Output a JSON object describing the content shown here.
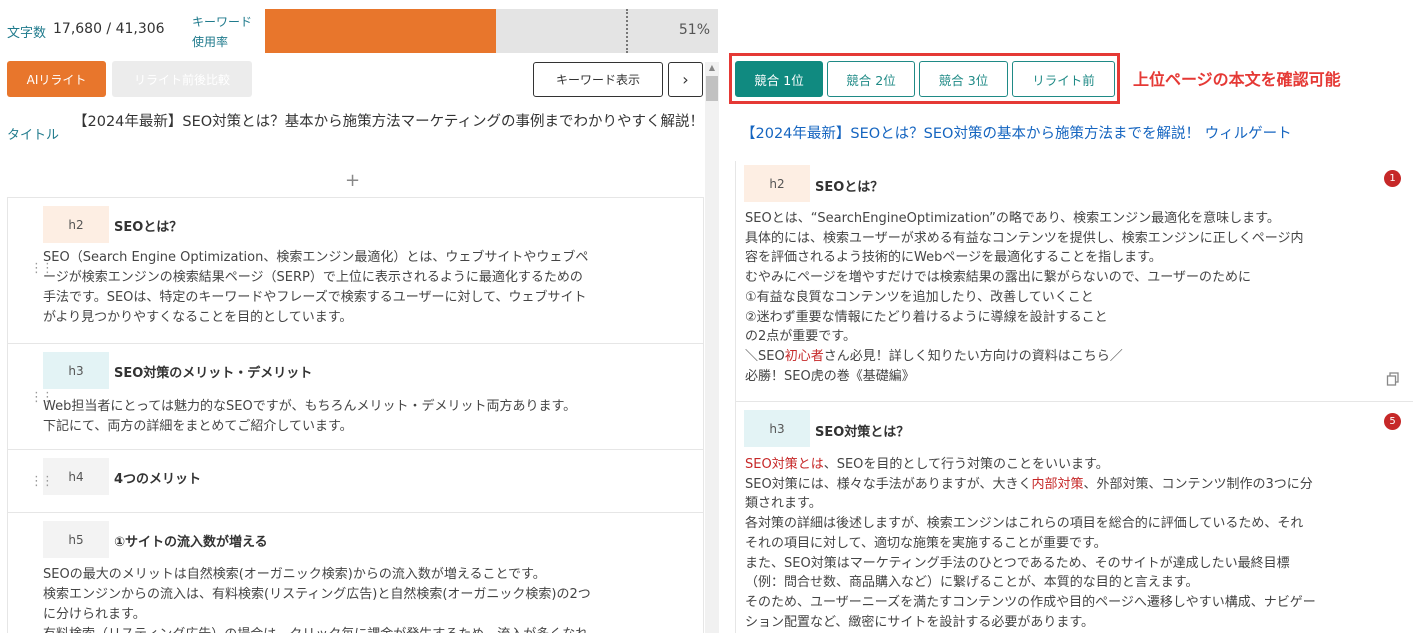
{
  "header": {
    "word_count_label": "文字数",
    "word_count_value": "17,680 / 41,306",
    "keyword_rate_label_1": "キーワード",
    "keyword_rate_label_2": "使用率",
    "keyword_rate": 51,
    "keyword_rate_text": "51%"
  },
  "toolbar": {
    "ai_rewrite": "AIリライト",
    "compare": "リライト前後比較",
    "keyword_display": "キーワード表示",
    "next": "›"
  },
  "article": {
    "title_label": "タイトル",
    "title": "【2024年最新】SEO対策とは？基本から施策方法マーケティングの事例までわかりやすく解説！",
    "add": "+",
    "blocks": [
      {
        "level": "h2",
        "heading": "SEOとは？",
        "lines": [
          "SEO（Search Engine Optimization、検索エンジン最適化）とは、ウェブサイトやウェブペ",
          "ージが検索エンジンの検索結果ページ（SERP）で上位に表示されるように最適化するための",
          "手法です。SEOは、特定のキーワードやフレーズで検索するユーザーに対して、ウェブサイト",
          "がより見つかりやすくなることを目的としています。"
        ]
      },
      {
        "level": "h3",
        "heading": "SEO対策のメリット・デメリット",
        "lines": [
          "Web担当者にとっては魅力的なSEOですが、もちろんメリット・デメリット両方あります。",
          "下記にて、両方の詳細をまとめてご紹介しています。"
        ]
      },
      {
        "level": "h4",
        "heading": "4つのメリット",
        "lines": []
      },
      {
        "level": "h5",
        "heading": "①サイトの流入数が増える",
        "lines": [
          "SEOの最大のメリットは自然検索(オーガニック検索)からの流入数が増えることです。",
          "検索エンジンからの流入は、有料検索(リスティング広告)と自然検索(オーガニック検索)の2つ",
          "に分けられます。",
          "有料検索（リスティング広告）の場合は、クリック毎に課金が発生するため、流入が多くなれ"
        ]
      }
    ]
  },
  "competitor": {
    "tabs": [
      "競合 1位",
      "競合 2位",
      "競合 3位",
      "リライト前"
    ],
    "active_tab": 0,
    "annotation": "上位ページの本文を確認可能",
    "title": "【2024年最新】SEOとは？SEO対策の基本から施策方法までを解説！ ウィルゲート",
    "sections": [
      {
        "level": "h2",
        "heading": "SEOとは？",
        "badge": "1",
        "lines": [
          "SEOとは、“SearchEngineOptimization”の略であり、検索エンジン最適化を意味します。",
          "具体的には、検索ユーザーが求める有益なコンテンツを提供し、検索エンジンに正しくページ内",
          "容を評価されるよう技術的にWebページを最適化することを指します。",
          "むやみにページを増やすだけでは検索結果の露出に繋がらないので、ユーザーのために",
          "①有益な良質なコンテンツを追加したり、改善していくこと",
          "②迷わず重要な情報にたどり着けるように導線を設計すること",
          "の2点が重要です。"
        ],
        "line8_a": "＼SEO",
        "line8_red": "初心者",
        "line8_b": "さん必見！詳しく知りたい方向けの資料はこちら／",
        "line9": "必勝！SEO虎の巻《基礎編》"
      },
      {
        "level": "h3",
        "heading": "SEO対策とは？",
        "badge": "5",
        "l1_red": "SEO対策とは",
        "l1_rest": "、SEOを目的として行う対策のことをいいます。",
        "l2_a": "SEO対策には、様々な手法がありますが、大きく",
        "l2_red": "内部対策",
        "l2_b": "、外部対策、コンテンツ制作の3つに分",
        "lines": [
          "類されます。",
          "各対策の詳細は後述しますが、検索エンジンはこれらの項目を総合的に評価しているため、それ",
          "それの項目に対して、適切な施策を実施することが重要です。",
          "また、SEO対策はマーケティング手法のひとつであるため、そのサイトが達成したい最終目標",
          "（例：問合せ数、商品購入など）に繋げることが、本質的な目的と言えます。",
          "そのため、ユーザーニーズを満たすコンテンツの作成や目的ページへ遷移しやすい構成、ナビゲー",
          "ション配置など、緻密にサイトを設計する必要があります。"
        ]
      }
    ]
  },
  "colors": {
    "accent": "#e8762c",
    "teal": "#108a80",
    "highlight": "#e53935"
  },
  "icons": {
    "drag": "drag-handle-icon",
    "copy": "copy-icon",
    "next": "chevron-right-icon"
  }
}
